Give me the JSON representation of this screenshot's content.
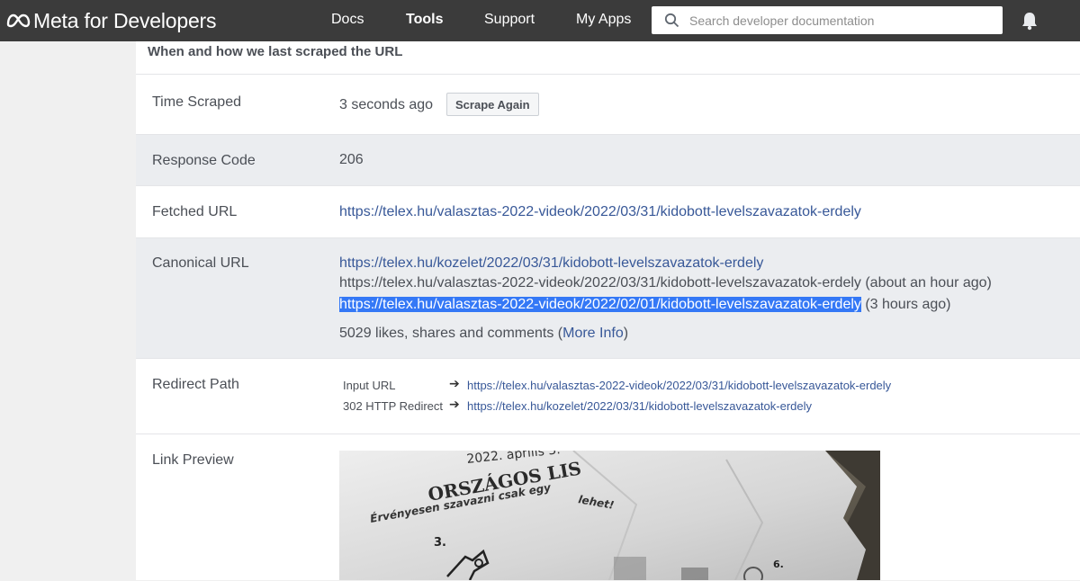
{
  "nav": {
    "logo_text": "Meta for Developers",
    "items": [
      "Docs",
      "Tools",
      "Support",
      "My Apps"
    ],
    "search_placeholder": "Search developer documentation"
  },
  "section": {
    "title": "When and how we last scraped the URL"
  },
  "time_scraped": {
    "label": "Time Scraped",
    "value": "3 seconds ago",
    "button": "Scrape Again"
  },
  "response_code": {
    "label": "Response Code",
    "value": "206"
  },
  "fetched_url": {
    "label": "Fetched URL",
    "value": "https://telex.hu/valasztas-2022-videok/2022/03/31/kidobott-levelszavazatok-erdely"
  },
  "canonical_url": {
    "label": "Canonical URL",
    "line1": "https://telex.hu/kozelet/2022/03/31/kidobott-levelszavazatok-erdely",
    "line2_url": "https://telex.hu/valasztas-2022-videok/2022/03/31/kidobott-levelszavazatok-erdely",
    "line2_note": " (about an hour ago)",
    "line3_url": "https://telex.hu/valasztas-2022-videok/2022/02/01/kidobott-levelszavazatok-erdely",
    "line3_note": " (3 hours ago)",
    "engagement_prefix": "5029 likes, shares and comments (",
    "more_info": "More Info",
    "engagement_suffix": ")"
  },
  "redirect_path": {
    "label": "Redirect Path",
    "steps": [
      {
        "label": "Input URL",
        "url": "https://telex.hu/valasztas-2022-videok/2022/03/31/kidobott-levelszavazatok-erdely"
      },
      {
        "label": "302 HTTP Redirect",
        "url": "https://telex.hu/kozelet/2022/03/31/kidobott-levelszavazatok-erdely"
      }
    ]
  },
  "link_preview": {
    "label": "Link Preview",
    "image_text": {
      "date": "2022. április 3.",
      "heading": "ORSZÁGOS LIS",
      "subline": "Érvényesen szavazni csak egy",
      "subline2": "lehet!",
      "number3": "3.",
      "number6": "6."
    }
  },
  "colors": {
    "topbar": "#3b3b3b",
    "link": "#385898",
    "highlight": "#3478f6",
    "shaded_row": "#ebedf0"
  }
}
